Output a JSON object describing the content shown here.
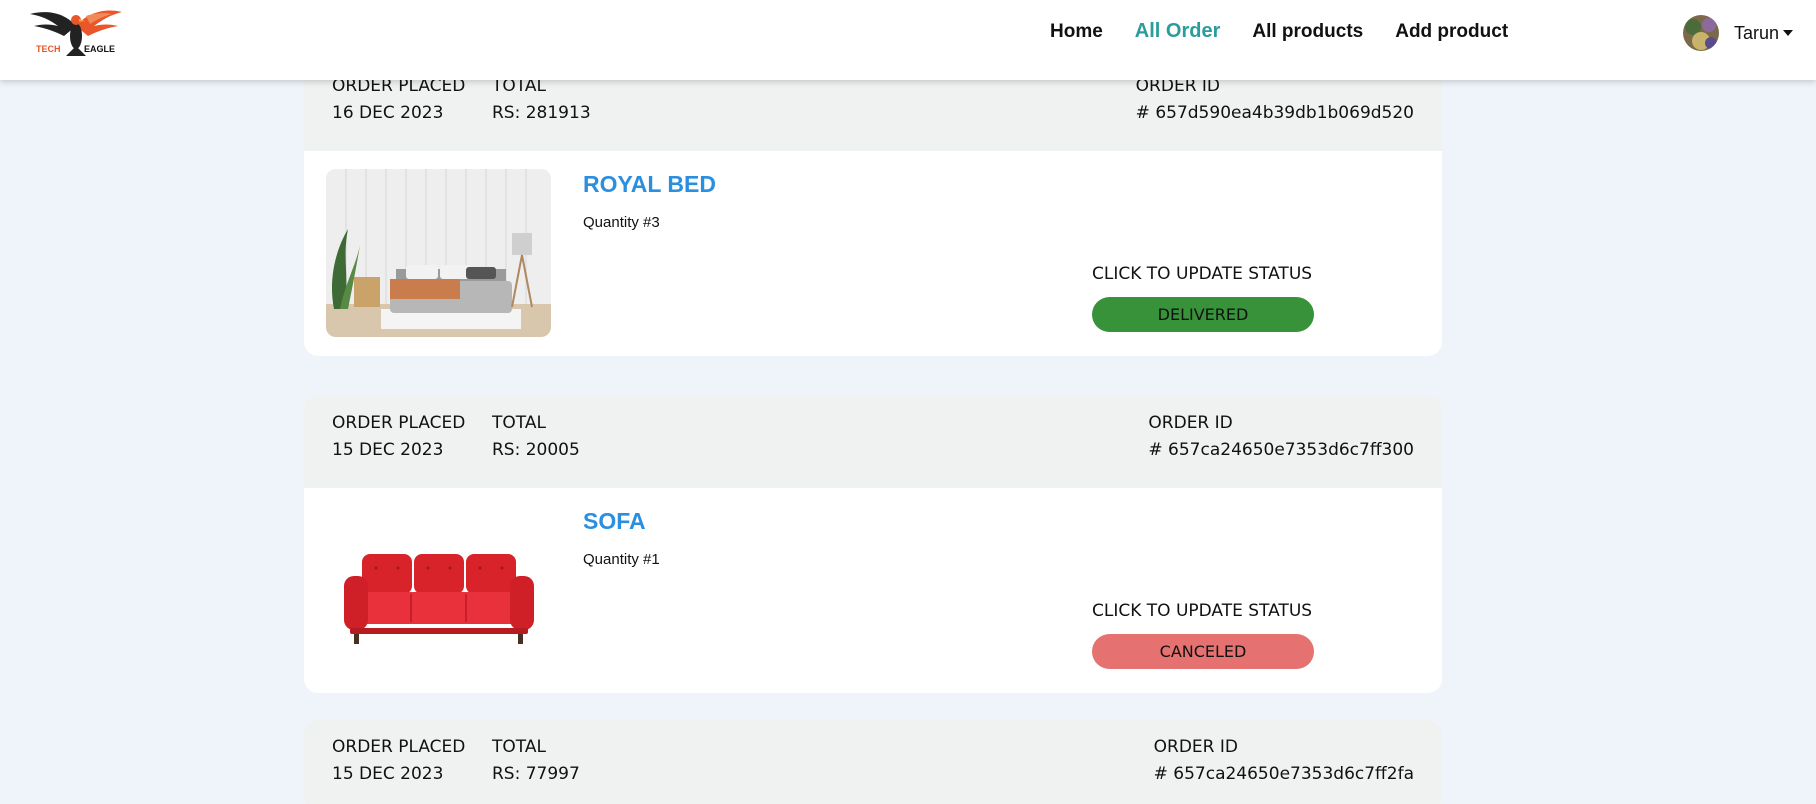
{
  "header": {
    "logo": {
      "text_left": "TECH",
      "text_right": "EAGLE",
      "icon": "eagle-logo-icon"
    },
    "nav": [
      {
        "label": "Home",
        "active": false
      },
      {
        "label": "All Order",
        "active": true
      },
      {
        "label": "All products",
        "active": false
      },
      {
        "label": "Add product",
        "active": false
      }
    ],
    "user": {
      "name": "Tarun",
      "icon": "chevron-down-icon"
    }
  },
  "orders": [
    {
      "placed_label": "ORDER PLACED",
      "placed_date": "16 DEC 2023",
      "total_label": "TOTAL",
      "total_value": "RS: 281913",
      "id_label": "ORDER ID",
      "id_value": "# 657d590ea4b39db1b069d520",
      "product": {
        "name": "ROYAL BED",
        "quantity": "Quantity #3",
        "image": "bed-image"
      },
      "status_label": "CLICK TO UPDATE STATUS",
      "status": "DELIVERED",
      "status_color": "#37923a"
    },
    {
      "placed_label": "ORDER PLACED",
      "placed_date": "15 DEC 2023",
      "total_label": "TOTAL",
      "total_value": "RS: 20005",
      "id_label": "ORDER ID",
      "id_value": "# 657ca24650e7353d6c7ff300",
      "product": {
        "name": "SOFA",
        "quantity": "Quantity #1",
        "image": "sofa-image"
      },
      "status_label": "CLICK TO UPDATE STATUS",
      "status": "CANCELED",
      "status_color": "#e67171"
    },
    {
      "placed_label": "ORDER PLACED",
      "placed_date": "15 DEC 2023",
      "total_label": "TOTAL",
      "total_value": "RS: 77997",
      "id_label": "ORDER ID",
      "id_value": "# 657ca24650e7353d6c7ff2fa"
    }
  ],
  "colors": {
    "accent": "#2a9d9b",
    "product_link": "#2b8fe0"
  }
}
